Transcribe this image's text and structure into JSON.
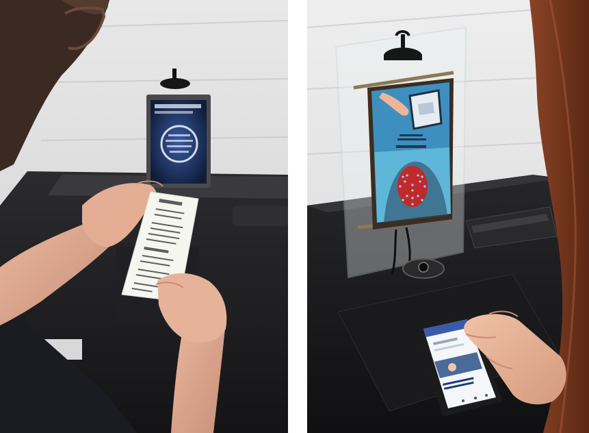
{
  "image": {
    "panels": [
      {
        "subject": "left-photo-receipt-reading"
      },
      {
        "subject": "right-photo-face-tracking-display"
      }
    ]
  },
  "colors": {
    "wall": "#dcdcdc",
    "wall_shadow": "#bfbfbf",
    "pedestal": "#1c1c1e",
    "pedestal_top": "#2a2a2d",
    "skin": "#e6b39a",
    "skin_shadow": "#c98f78",
    "receipt": "#f4f4f0",
    "screen_blue": "#3f8fbf",
    "screen_dark": "#1d2a4a",
    "hair": "#7a3a1e",
    "face_red": "#c02a2a",
    "tracking_dots": "#9fd8ff"
  }
}
